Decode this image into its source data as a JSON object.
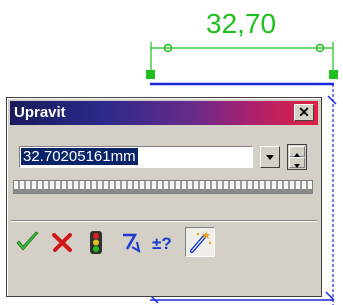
{
  "dimension": {
    "value_text": "32,70",
    "color": "#1fbf1f"
  },
  "sketch": {
    "line_color": "#1a2ae0",
    "handle_color": "#1fbf1f"
  },
  "dialog": {
    "title": "Upravit",
    "close_icon": "close-icon",
    "value": "32.70205161mm",
    "toolbar": [
      {
        "name": "ok-button",
        "icon": "checkmark-icon"
      },
      {
        "name": "cancel-button",
        "icon": "red-x-icon"
      },
      {
        "name": "rebuild-button",
        "icon": "traffic-light-icon"
      },
      {
        "name": "reverse-direction-button",
        "icon": "reverse-arrow-icon"
      },
      {
        "name": "tolerance-button",
        "icon": "plus-minus-question-icon"
      },
      {
        "name": "mark-for-drawing-button",
        "icon": "magic-wand-icon",
        "active": true
      }
    ]
  }
}
